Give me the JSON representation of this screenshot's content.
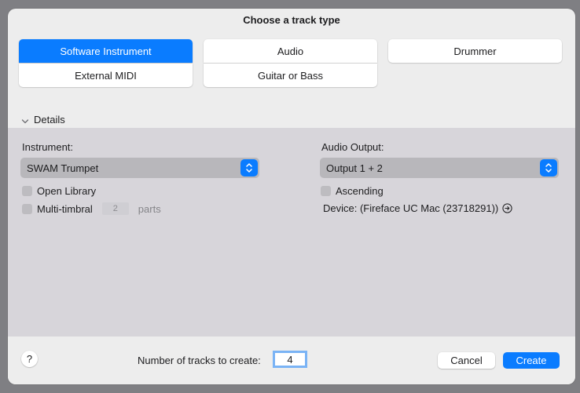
{
  "dialog": {
    "title": "Choose a track type"
  },
  "track_types": {
    "software_instrument": "Software Instrument",
    "external_midi": "External MIDI",
    "audio": "Audio",
    "guitar_or_bass": "Guitar or Bass",
    "drummer": "Drummer",
    "selected": "software_instrument"
  },
  "details": {
    "toggle_label": "Details",
    "instrument": {
      "label": "Instrument:",
      "value": "SWAM Trumpet"
    },
    "open_library": {
      "label": "Open Library",
      "checked": false
    },
    "multi_timbral": {
      "label": "Multi-timbral",
      "parts_value": "2",
      "parts_label": "parts",
      "checked": false
    },
    "audio_output": {
      "label": "Audio Output:",
      "value": "Output 1 + 2"
    },
    "ascending": {
      "label": "Ascending",
      "checked": false
    },
    "device": {
      "text": "Device: (Fireface UC Mac (23718291))"
    }
  },
  "footer": {
    "help_label": "?",
    "count_label": "Number of tracks to create:",
    "count_value": "4",
    "cancel_label": "Cancel",
    "create_label": "Create"
  },
  "colors": {
    "accent": "#0a7cff",
    "panel_bg": "#d7d5da",
    "dialog_bg": "#ededed"
  }
}
